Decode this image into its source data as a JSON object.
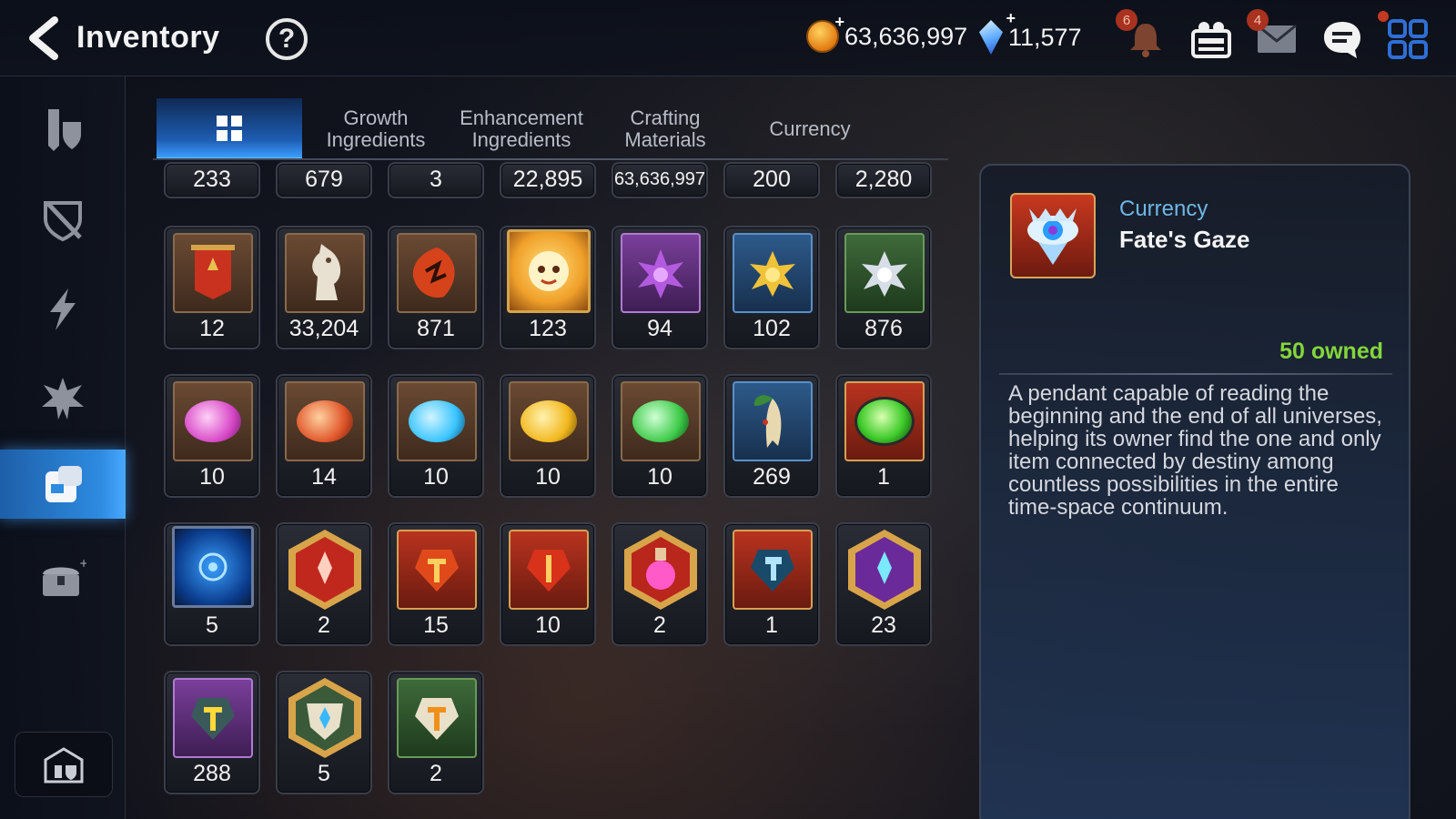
{
  "header": {
    "title": "Inventory",
    "help_symbol": "?",
    "gold": "63,636,997",
    "crystals": "11,577",
    "plus_symbol": "+",
    "notifications_badge": "6",
    "mail_badge": "4"
  },
  "icons": {
    "back": "chevron-left-icon",
    "help": "question-icon",
    "gold": "gold-coin-icon",
    "crystal": "crystal-icon",
    "bell": "bell-icon",
    "hero_lineup": "heroes-icon",
    "mail": "mail-icon",
    "chat": "chat-icon",
    "menu": "grid-menu-icon"
  },
  "sidebar": {
    "items": [
      {
        "name": "equipment-tab-icon",
        "active": false
      },
      {
        "name": "artifact-tab-icon",
        "active": false
      },
      {
        "name": "skill-tab-icon",
        "active": false
      },
      {
        "name": "ultimate-tab-icon",
        "active": false
      },
      {
        "name": "materials-tab-icon",
        "active": true
      },
      {
        "name": "chest-tab-icon",
        "active": false
      }
    ],
    "bottom": "storage-icon"
  },
  "tabs": [
    {
      "label": "",
      "icon": "grid-icon",
      "active": true
    },
    {
      "label": "Growth\nIngredients",
      "active": false
    },
    {
      "label": "Enhancement\nIngredients",
      "active": false
    },
    {
      "label": "Crafting\nMaterials",
      "active": false
    },
    {
      "label": "Currency",
      "active": false
    }
  ],
  "items_partial_row": [
    "233",
    "679",
    "3",
    "22,895",
    "63,636,997",
    "200",
    "2,280"
  ],
  "items": [
    {
      "count": "12",
      "icon": "banner-icon",
      "frame": "brown"
    },
    {
      "count": "33,204",
      "icon": "horse-head-icon",
      "frame": "brown"
    },
    {
      "count": "871",
      "icon": "leaf-icon",
      "frame": "brown"
    },
    {
      "count": "123",
      "icon": "mascot-icon",
      "frame": "circle"
    },
    {
      "count": "94",
      "icon": "purple-flower-icon",
      "frame": "purple"
    },
    {
      "count": "102",
      "icon": "gold-flower-icon",
      "frame": "blue"
    },
    {
      "count": "876",
      "icon": "silver-flower-icon",
      "frame": "green"
    },
    {
      "count": "10",
      "icon": "pink-gem-icon",
      "frame": "brown",
      "color": "#d84ac8"
    },
    {
      "count": "14",
      "icon": "red-gem-icon",
      "frame": "brown",
      "color": "#e0562a"
    },
    {
      "count": "10",
      "icon": "blue-gem-icon",
      "frame": "brown",
      "color": "#3ac4ff"
    },
    {
      "count": "10",
      "icon": "yellow-gem-icon",
      "frame": "brown",
      "color": "#f2b81e"
    },
    {
      "count": "10",
      "icon": "green-gem-icon",
      "frame": "brown",
      "color": "#3fcb4a"
    },
    {
      "count": "269",
      "icon": "ginseng-icon",
      "frame": "blue"
    },
    {
      "count": "1",
      "icon": "emerald-icon",
      "frame": "red"
    },
    {
      "count": "5",
      "icon": "blue-rune-icon",
      "frame": "circle"
    },
    {
      "count": "2",
      "icon": "red-hex-stone-icon",
      "frame": "hex"
    },
    {
      "count": "15",
      "icon": "red-stone-icon",
      "frame": "red"
    },
    {
      "count": "10",
      "icon": "red-stone-icon",
      "frame": "red"
    },
    {
      "count": "2",
      "icon": "potion-icon",
      "frame": "hex"
    },
    {
      "count": "1",
      "icon": "blue-hammer-stone-icon",
      "frame": "red"
    },
    {
      "count": "23",
      "icon": "purple-hex-stone-icon",
      "frame": "hex"
    },
    {
      "count": "288",
      "icon": "yellow-stone-icon",
      "frame": "purple"
    },
    {
      "count": "5",
      "icon": "white-hex-stone-icon",
      "frame": "hex"
    },
    {
      "count": "2",
      "icon": "white-stone-icon",
      "frame": "green"
    }
  ],
  "detail": {
    "category": "Currency",
    "name": "Fate's Gaze",
    "owned": "50 owned",
    "description": "A pendant capable of reading the beginning and the end of all universes, helping its owner find the one and only item connected by destiny among countless possibilities in the entire time-space continuum.",
    "icon": "eye-pendant-icon"
  },
  "colors": {
    "accent_blue": "#2d8be0",
    "owned_green": "#83d63b",
    "category_blue": "#6fb7e6"
  }
}
